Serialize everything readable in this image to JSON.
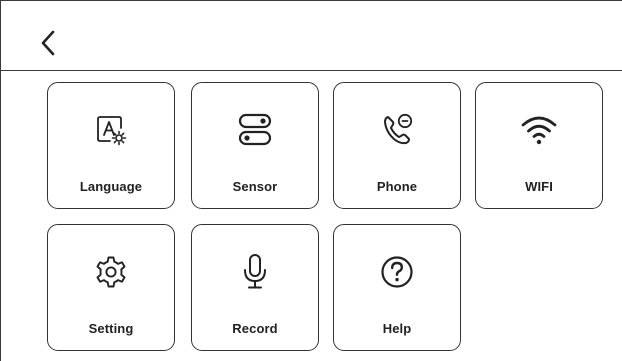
{
  "header": {
    "back_icon": "chevron-left-icon"
  },
  "tiles": [
    {
      "label": "Language",
      "icon": "language-settings-icon"
    },
    {
      "label": "Sensor",
      "icon": "toggle-switches-icon"
    },
    {
      "label": "Phone",
      "icon": "phone-call-icon"
    },
    {
      "label": "WIFI",
      "icon": "wifi-icon"
    },
    {
      "label": "Setting",
      "icon": "gear-icon"
    },
    {
      "label": "Record",
      "icon": "microphone-icon"
    },
    {
      "label": "Help",
      "icon": "question-circle-icon"
    }
  ],
  "colors": {
    "line": "#333333",
    "text": "#222222",
    "background": "#ffffff"
  }
}
